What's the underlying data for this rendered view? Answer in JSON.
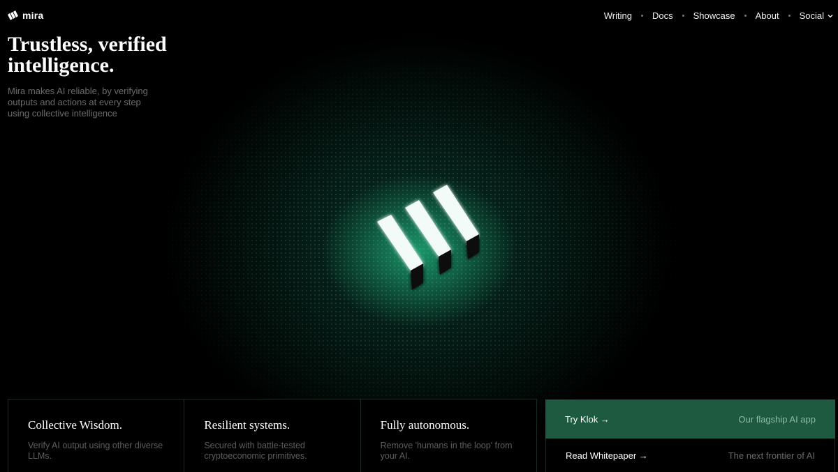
{
  "brand": {
    "name": "mira",
    "icon": "mira-logo-icon"
  },
  "nav": {
    "items": [
      {
        "label": "Writing"
      },
      {
        "label": "Docs"
      },
      {
        "label": "Showcase"
      },
      {
        "label": "About"
      },
      {
        "label": "Social",
        "icon": "chevron-down-icon"
      }
    ]
  },
  "hero": {
    "title": "Trustless, verified intelligence.",
    "subtitle": "Mira makes AI reliable, by verifying outputs and actions at every step using collective intelligence"
  },
  "features": [
    {
      "title": "Collective Wisdom.",
      "description": "Verify AI output using other diverse LLMs."
    },
    {
      "title": "Resilient systems.",
      "description": "Secured with battle-tested cryptoeconomic primitives."
    },
    {
      "title": "Fully autonomous.",
      "description": "Remove 'humans in the loop' from your AI."
    }
  ],
  "cta": {
    "primary": {
      "label": "Try Klok →",
      "note": "Our flagship AI app"
    },
    "secondary": {
      "label": "Read Whitepaper →",
      "note": "The next frontier of AI"
    }
  },
  "colors": {
    "accent": "#1d5a3f",
    "glow": "#28e6a0",
    "background": "#000000"
  }
}
